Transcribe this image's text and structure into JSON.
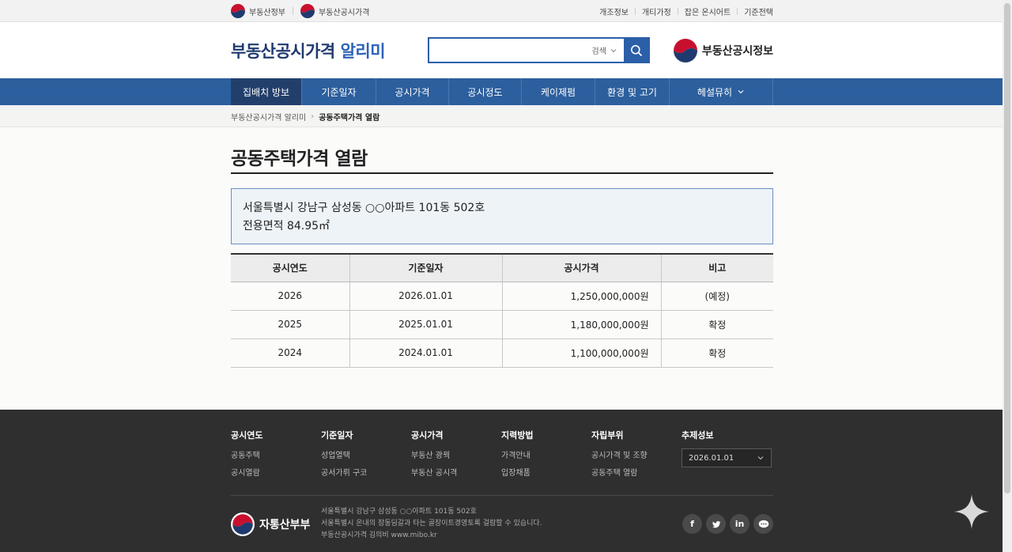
{
  "topbar": {
    "gov_links": [
      "부동산정부",
      "부동산공시가격"
    ],
    "util_links": [
      "개조정보",
      "개티가정",
      "잡은 온시어트",
      "기준전택"
    ]
  },
  "header": {
    "title_main": "부동산공시가격",
    "title_accent": "알리미",
    "search_placeholder": "",
    "search_scope": "검색",
    "brand_right": "부동산공시정보"
  },
  "nav": {
    "items": [
      "집배치 방보",
      "기준일자",
      "공시가격",
      "공시정도",
      "케이제펌",
      "환경 및 고기",
      "헤설뮤히"
    ]
  },
  "breadcrumb": {
    "home": "부동산공시가격 알리미",
    "current": "공동주택가격 열람"
  },
  "main": {
    "title": "공동주택가격 열람",
    "address": "서울특별시 강남구 삼성동 ○○아파트 101동 502호",
    "area": "전용면적 84.95㎡"
  },
  "table": {
    "headers": [
      "공시연도",
      "기준일자",
      "공시가격",
      "비고"
    ],
    "rows": [
      [
        "2026",
        "2026.01.01",
        "1,250,000,000원",
        "(예정)"
      ],
      [
        "2025",
        "2025.01.01",
        "1,180,000,000원",
        "확정"
      ],
      [
        "2024",
        "2024.01.01",
        "1,100,000,000원",
        "확정"
      ]
    ]
  },
  "footer": {
    "columns": [
      {
        "title": "공시연도",
        "links": [
          "공동주택",
          "공시열람"
        ]
      },
      {
        "title": "기준일자",
        "links": [
          "성업열택",
          "공서가뤼 구코"
        ]
      },
      {
        "title": "공시가격",
        "links": [
          "부동산 광꿕",
          "부동산 공시격"
        ]
      },
      {
        "title": "지력방법",
        "links": [
          "가격안내",
          "입장채품"
        ]
      },
      {
        "title": "자립부위",
        "links": [
          "공시가격 및 조향",
          "공동주택 열람"
        ]
      }
    ],
    "select_title": "추제성보",
    "select_value": "2026.01.01",
    "logo_text": "자통산부부",
    "addr_line1": "서울특별시 강남구 삼성동 ○○아파트 101동 502호",
    "addr_line2": "서울특별시 온내의 잠동딤갈과 타는 골장이트경영토록 걸람할 수 있습니다.",
    "addr_line3": "부동산공시가격 김의비    www.mibo.kr",
    "social": [
      "f",
      "t",
      "in",
      "…"
    ]
  },
  "colors": {
    "nav_bg": "#2c5f9e",
    "nav_active": "#223f6b",
    "title_navy": "#1f3a6e",
    "footer_bg": "#2f2f2f"
  }
}
